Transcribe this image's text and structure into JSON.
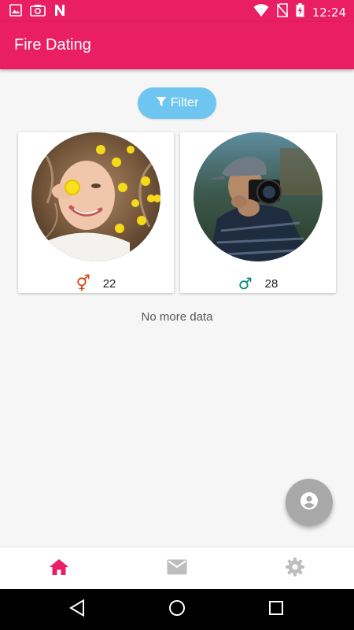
{
  "status_bar": {
    "time": "12:24",
    "icons": [
      "image-icon",
      "camera-icon",
      "n-notification-icon",
      "wifi-icon",
      "no-sim-icon",
      "battery-charging-icon"
    ]
  },
  "app_bar": {
    "title": "Fire Dating"
  },
  "filter": {
    "label": "Filter",
    "icon": "filter-icon"
  },
  "profiles": [
    {
      "age": "22",
      "gender_symbol": "⚥",
      "gender_color": "#d84315",
      "photo": "woman-with-yellow-flowers"
    },
    {
      "age": "28",
      "gender_symbol": "♂",
      "gender_color": "#00897b",
      "photo": "man-with-camera"
    }
  ],
  "list_footer": "No more data",
  "fab": {
    "icon": "account-circle-icon"
  },
  "bottom_nav": {
    "items": [
      {
        "icon": "home-icon",
        "active": true
      },
      {
        "icon": "mail-icon",
        "active": false
      },
      {
        "icon": "settings-icon",
        "active": false
      }
    ]
  },
  "colors": {
    "primary": "#e91e63",
    "filter_button": "#6ec6f0",
    "fab": "#a8a8a8",
    "inactive_icon": "#bdbdbd"
  }
}
